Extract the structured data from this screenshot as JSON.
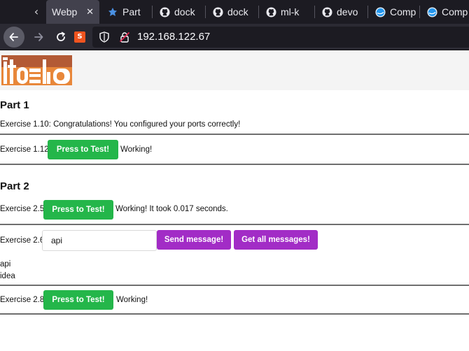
{
  "browser": {
    "tabs": [
      {
        "label": "Webp",
        "icon": "none",
        "active": true
      },
      {
        "label": "Part",
        "icon": "star-icon"
      },
      {
        "label": "dock",
        "icon": "github-icon"
      },
      {
        "label": "dock",
        "icon": "github-icon"
      },
      {
        "label": "ml-k",
        "icon": "github-icon"
      },
      {
        "label": "devo",
        "icon": "github-icon"
      },
      {
        "label": "Comp",
        "icon": "docker-icon"
      },
      {
        "label": "Comp",
        "icon": "docker-icon"
      }
    ],
    "url": "192.168.122.67",
    "extension_letter": "S"
  },
  "page": {
    "part1": {
      "title": "Part 1",
      "ex110": "Exercise 1.10: Congratulations! You configured your ports correctly!",
      "ex112_label": "Exercise 1.12:",
      "ex112_button": "Press to Test!",
      "ex112_status": "Working!"
    },
    "part2": {
      "title": "Part 2",
      "ex25_label": "Exercise 2.5:",
      "ex25_button": "Press to Test!",
      "ex25_status": "Working! It took 0.017 seconds.",
      "ex26_label": "Exercise 2.6:",
      "ex26_input_value": "api",
      "ex26_send_button": "Send message!",
      "ex26_get_button": "Get all messages!",
      "messages": [
        "api",
        "idea"
      ],
      "ex28_label": "Exercise 2.8:",
      "ex28_button": "Press to Test!",
      "ex28_status": "Working!"
    }
  },
  "colors": {
    "green_button": "#24b64a",
    "purple_button": "#a22cc6",
    "logo_brown": "#b35a35",
    "logo_orange": "#e8873a"
  }
}
